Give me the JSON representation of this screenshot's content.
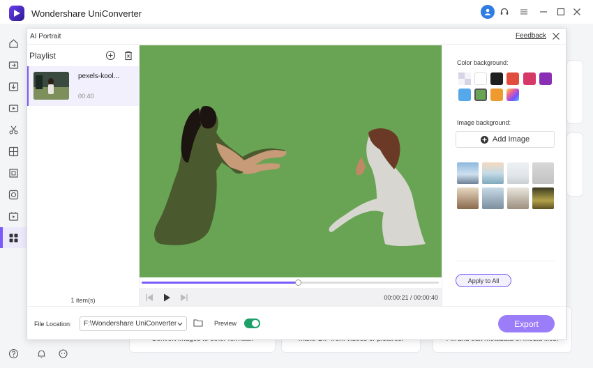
{
  "app": {
    "title": "Wondershare UniConverter"
  },
  "nav": {
    "items": [
      "home-icon",
      "convert-icon",
      "download-icon",
      "record-icon",
      "cut-icon",
      "merge-icon",
      "compress-icon",
      "burn-icon",
      "player-icon",
      "toolbox-icon"
    ],
    "active": "toolbox-icon",
    "bottom": [
      "help-icon",
      "bell-icon",
      "feedback-icon"
    ]
  },
  "background_cards": [
    {
      "text": "Convert images to other formats."
    },
    {
      "text": "Make GIF from videos or pictures."
    },
    {
      "text": "Fix and edit metadata of media files."
    }
  ],
  "dialog": {
    "title": "AI Portrait",
    "feedback": "Feedback"
  },
  "playlist": {
    "title": "Playlist",
    "items": [
      {
        "name": "pexels-kool...",
        "duration": "00:40"
      }
    ],
    "count": "1 item(s)"
  },
  "player": {
    "current_time": "00:00:21",
    "total_time": "00:00:40",
    "time_display": "00:00:21 / 00:00:40",
    "progress_fraction": 0.525
  },
  "right_panel": {
    "color_label": "Color background:",
    "colors": [
      "transparent",
      "#ffffff",
      "#1f1f1f",
      "#e14d3c",
      "#d63868",
      "#8a2fb3",
      "#55a9ea",
      "#68a453",
      "#ef9a2e",
      "rainbow"
    ],
    "selected_color": "#68a453",
    "image_label": "Image background:",
    "add_image": "Add Image",
    "apply_all": "Apply to All"
  },
  "footer": {
    "file_location_label": "File Location:",
    "file_location_value": "F:\\Wondershare UniConverter",
    "preview_label": "Preview",
    "preview_enabled": true,
    "export": "Export"
  }
}
